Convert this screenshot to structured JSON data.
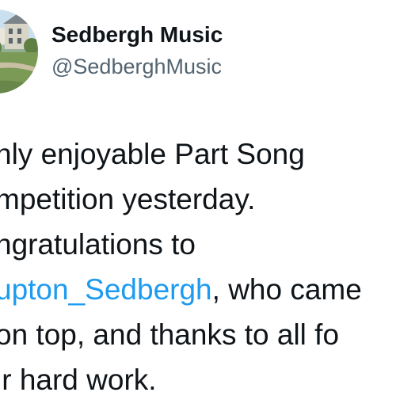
{
  "profile": {
    "display_name": "Sedbergh Music",
    "handle": "@SedberghMusic",
    "avatar_icon": "building-photo-avatar"
  },
  "tweet": {
    "lines": [
      "hly enjoyable Part Song",
      "mpetition yesterday.",
      "ngratulations to"
    ],
    "mention": "upton_Sedbergh",
    "line4_after_mention": ", who came",
    "line5": " on top, and thanks to all fo",
    "line6": "ir hard work."
  },
  "colors": {
    "text": "#0f1419",
    "secondary": "#536471",
    "link": "#1d9bf0"
  }
}
